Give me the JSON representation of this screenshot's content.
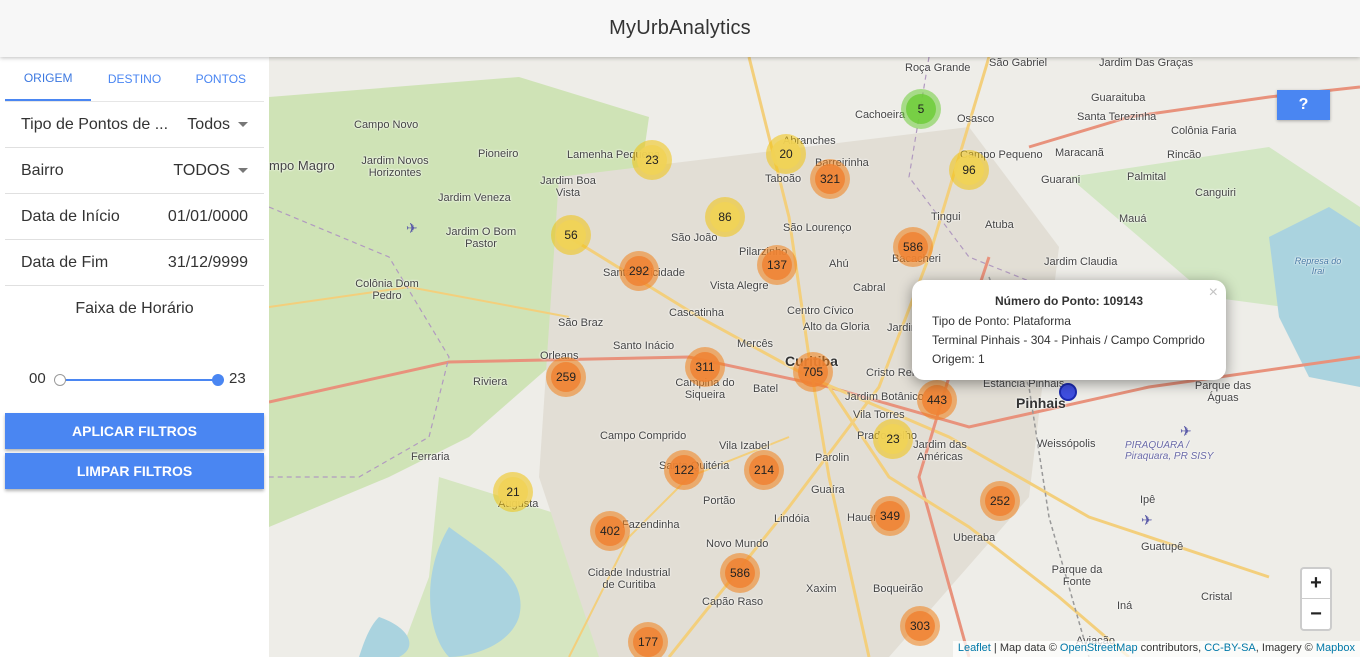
{
  "app": {
    "title": "MyUrbAnalytics"
  },
  "tabs": [
    {
      "label": "ORIGEM",
      "active": true
    },
    {
      "label": "DESTINO",
      "active": false
    },
    {
      "label": "PONTOS",
      "active": false
    }
  ],
  "filters": {
    "tipo_pontos": {
      "label": "Tipo de Pontos de ...",
      "value": "Todos"
    },
    "bairro": {
      "label": "Bairro",
      "value": "TODOS"
    },
    "data_inicio": {
      "label": "Data de Início",
      "value": "01/01/0000"
    },
    "data_fim": {
      "label": "Data de Fim",
      "value": "31/12/9999"
    },
    "faixa": {
      "label": "Faixa de Horário",
      "min": "00",
      "max": "23",
      "range": [
        0,
        23
      ]
    }
  },
  "buttons": {
    "apply": "APLICAR FILTROS",
    "clear": "LIMPAR FILTROS"
  },
  "map": {
    "help_label": "?",
    "zoom_in": "+",
    "zoom_out": "−",
    "attribution": {
      "leaflet": "Leaflet",
      "map_data": " | Map data © ",
      "osm": "OpenStreetMap",
      "contributors": " contributors, ",
      "license": "CC-BY-SA",
      "imagery": ", Imagery © ",
      "mapbox": "Mapbox"
    },
    "places": [
      "Roça Grande",
      "São Gabriel",
      "Jardim Das Graças",
      "Guaraituba",
      "Osasco",
      "Santa Terezinha",
      "Colônia Faria",
      "Campo Novo",
      "Cachoeira",
      "Abranches",
      "Pioneiro",
      "Lamenha Pequena",
      "Barreirinha",
      "Campo Pequeno",
      "Maracanã",
      "Rincão",
      "mpo Magro",
      "Jardim Novos Horizontes",
      "Jardim Boa Vista",
      "Taboão",
      "Guarani",
      "Palmital",
      "Canguiri",
      "Jardim Veneza",
      "Tingui",
      "Atuba",
      "Mauá",
      "Jardim O Bom Pastor",
      "São João",
      "São Lourenço",
      "Jardim Claudia",
      "Santa Felicidade",
      "Pilarzinho",
      "Ahú",
      "Bacacheri",
      "Colônia Dom Pedro",
      "Vista Alegre",
      "Cabral",
      "São Braz",
      "Cascatinha",
      "Centro Cívico",
      "Alto da Gloria",
      "Jardim",
      "Santo Inácio",
      "Mercês",
      "Curitiba",
      "Orleans",
      "Cristo Rei",
      "Campina do Siqueira",
      "Batel",
      "Jardim Botânico",
      "Estância Pinhais",
      "Pinhais",
      "Parque das Águas",
      "Riviera",
      "Vila Torres",
      "Campo Comprido",
      "Vila Izabel",
      "Prado Velho",
      "Jardim das Américas",
      "Weissópolis",
      "PIRAQUARA / Piraquara, PR SISY",
      "Ferraria",
      "Santa Quitéria",
      "Parolin",
      "Guaíra",
      "Augusta",
      "Portão",
      "Hauer",
      "Ipê",
      "Fazendinha",
      "Lindóia",
      "Uberaba",
      "Guatupê",
      "Novo Mundo",
      "Cidade Industrial de Curitiba",
      "Parque da Fonte",
      "Xaxim",
      "Boqueirão",
      "Capão Raso",
      "Cristal",
      "Iná",
      "Represa do Irai",
      "Aviação"
    ],
    "clusters": [
      {
        "count": "5",
        "level": "green"
      },
      {
        "count": "23",
        "level": "yellow"
      },
      {
        "count": "20",
        "level": "yellow"
      },
      {
        "count": "321",
        "level": "orange"
      },
      {
        "count": "96",
        "level": "yellow"
      },
      {
        "count": "86",
        "level": "yellow"
      },
      {
        "count": "56",
        "level": "yellow"
      },
      {
        "count": "586",
        "level": "orange"
      },
      {
        "count": "292",
        "level": "orange"
      },
      {
        "count": "137",
        "level": "orange"
      },
      {
        "count": "311",
        "level": "orange"
      },
      {
        "count": "705",
        "level": "orange"
      },
      {
        "count": "259",
        "level": "orange"
      },
      {
        "count": "443",
        "level": "orange"
      },
      {
        "count": "23",
        "level": "yellow"
      },
      {
        "count": "122",
        "level": "orange"
      },
      {
        "count": "214",
        "level": "orange"
      },
      {
        "count": "252",
        "level": "orange"
      },
      {
        "count": "21",
        "level": "yellow"
      },
      {
        "count": "402",
        "level": "orange"
      },
      {
        "count": "349",
        "level": "orange"
      },
      {
        "count": "586",
        "level": "orange"
      },
      {
        "count": "303",
        "level": "orange"
      },
      {
        "count": "177",
        "level": "orange"
      }
    ],
    "popup": {
      "title": "Número do Ponto: 109143",
      "tipo": "Tipo de Ponto: Plataforma",
      "terminal": "Terminal Pinhais - 304 - Pinhais / Campo Comprido",
      "origem": "Origem: 1",
      "close": "×"
    },
    "colors": {
      "accent": "#4a86f2",
      "cluster_orange": "#f08232",
      "cluster_yellow": "#f1d357",
      "cluster_green": "#6ecc39"
    }
  }
}
